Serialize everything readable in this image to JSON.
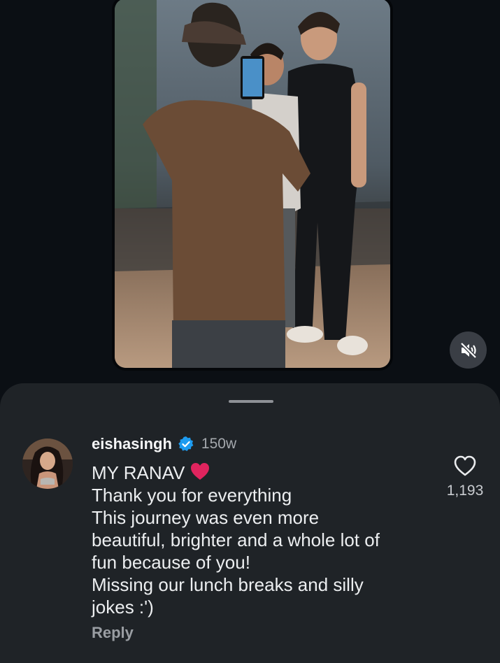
{
  "video": {
    "mute_icon": "speaker-muted-icon"
  },
  "comment": {
    "username": "eishasingh",
    "verified_icon": "verified-badge-icon",
    "timestamp": "150w",
    "lines": [
      "MY RANAV",
      "Thank you for everything",
      "This journey was even more",
      "beautiful, brighter and a whole lot of",
      "fun because of you!",
      "Missing our lunch breaks and silly",
      "jokes :')"
    ],
    "emoji": "red-heart-emoji",
    "reply_label": "Reply",
    "like_icon": "heart-outline-icon",
    "like_count": "1,193"
  },
  "colors": {
    "background": "#0b0f14",
    "sheet": "#1f2327",
    "verified": "#1d9bf0",
    "heart": "#e0245e",
    "muted_text": "#a4a8ad"
  }
}
